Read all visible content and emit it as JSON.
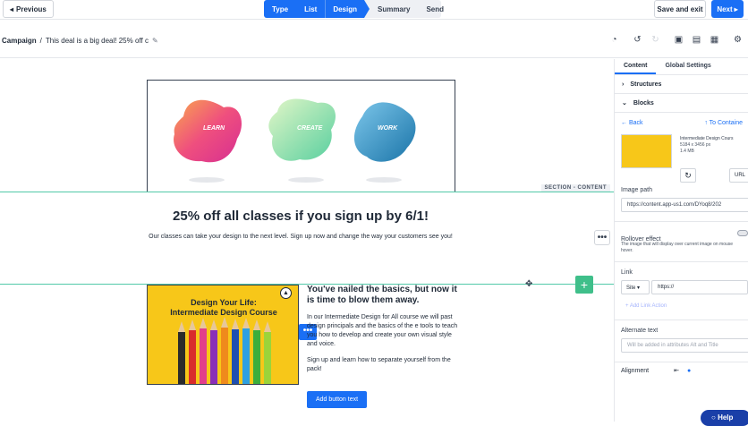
{
  "topbar": {
    "previous_label": "Previous",
    "steps": [
      "Type",
      "List",
      "Design",
      "Summary",
      "Send"
    ],
    "save_exit_label": "Save and exit",
    "next_label": "Next"
  },
  "subbar": {
    "campaign_label": "Campaign",
    "separator": "/",
    "campaign_name": "This deal is a big deal! 25% off c"
  },
  "canvas": {
    "blob_labels": [
      "LEARN",
      "CREATE",
      "WORK"
    ],
    "section_tag": "SECTION - CONTENT",
    "headline": "25% off all classes if you sign up by 6/1!",
    "body": "Our classes can take your design to the next level. Sign up now and change the way your customers see you!",
    "course_image_title_line1": "Design Your Life:",
    "course_image_title_line2": "Intermediate Design Course",
    "right_title": "You've nailed the basics, but now it is time to blow them away.",
    "right_para1": "In our Intermediate Design for All course we will past design principals and the basics of the e tools to teach you how to develop and create your own visual style and voice.",
    "right_para2": "Sign up and learn how to separate yourself from the pack!",
    "button_label": "Add button text"
  },
  "panel": {
    "tabs": [
      "Content",
      "Global Settings"
    ],
    "structures_label": "Structures",
    "blocks_label": "Blocks",
    "back_label": "Back",
    "to_container_label": "To Containe",
    "file_name": "Intermediate Design Cours",
    "file_dims": "5184 x 3456 px",
    "file_size": "1.4 MB",
    "url_label": "URL",
    "image_path_label": "Image path",
    "image_path_value": "https://content.app-us1.com/DYoq8/202",
    "rollover_label": "Rollover effect",
    "rollover_note": "The image that will display over current image on mouse hover.",
    "link_label": "Link",
    "site_label": "Site",
    "link_value": "https://",
    "add_link_action": "+ Add Link Action",
    "alt_text_label": "Alternate text",
    "alt_text_placeholder": "Will be added in attributes Alt and Title",
    "alignment_label": "Alignment"
  },
  "help_label": "Help",
  "colors": {
    "primary": "#1a6ff5",
    "accent_green": "#3fbf8a",
    "yellow": "#f7c719"
  }
}
